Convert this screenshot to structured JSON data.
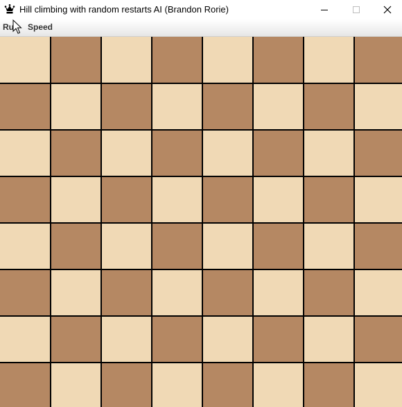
{
  "window": {
    "title": "Hill climbing with random restarts AI (Brandon Rorie)",
    "app_icon": "queen-icon"
  },
  "menu": {
    "items": [
      "Run",
      "Speed"
    ]
  },
  "board": {
    "rows": 8,
    "cols": 8,
    "light_color": "#f0d9b5",
    "dark_color": "#b58863",
    "grid_color": "#000000",
    "top_left": "light"
  }
}
